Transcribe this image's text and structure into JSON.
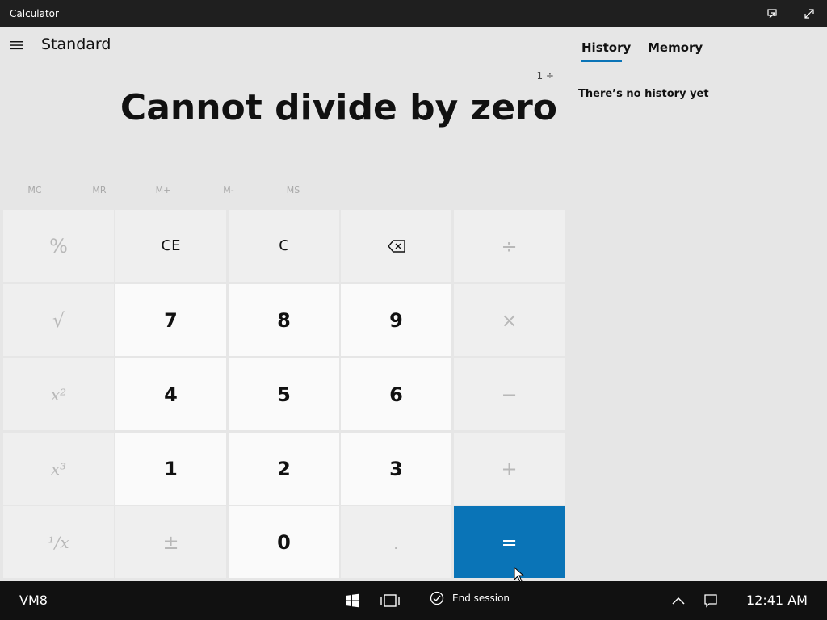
{
  "window": {
    "title": "Calculator",
    "buttons": [
      "keep-on-top-icon",
      "maximize-icon"
    ]
  },
  "app": {
    "mode": "Standard",
    "expression": "1 ÷",
    "display": "Cannot divide by zero"
  },
  "memory": {
    "buttons": [
      "MC",
      "MR",
      "M+",
      "M-",
      "MS"
    ]
  },
  "keys": [
    [
      "%",
      "CE",
      "C",
      "⌫",
      "÷"
    ],
    [
      "√",
      "7",
      "8",
      "9",
      "×"
    ],
    [
      "x²",
      "4",
      "5",
      "6",
      "−"
    ],
    [
      "x³",
      "1",
      "2",
      "3",
      "+"
    ],
    [
      "¹/x",
      "±",
      "0",
      ".",
      "="
    ]
  ],
  "history_pane": {
    "tabs": [
      "History",
      "Memory"
    ],
    "active_tab": "History",
    "empty_text": "There’s no history yet"
  },
  "taskbar": {
    "label": "VM8",
    "end_session": "End session",
    "time": "12:41 AM"
  },
  "colors": {
    "accent": "#0a74b7",
    "titlebar": "#1f1f1f",
    "taskbar": "#111111",
    "background": "#e6e6e6",
    "number_key": "#fafafa",
    "operator_key": "#efefef",
    "disabled_text": "#b8b8b8"
  }
}
